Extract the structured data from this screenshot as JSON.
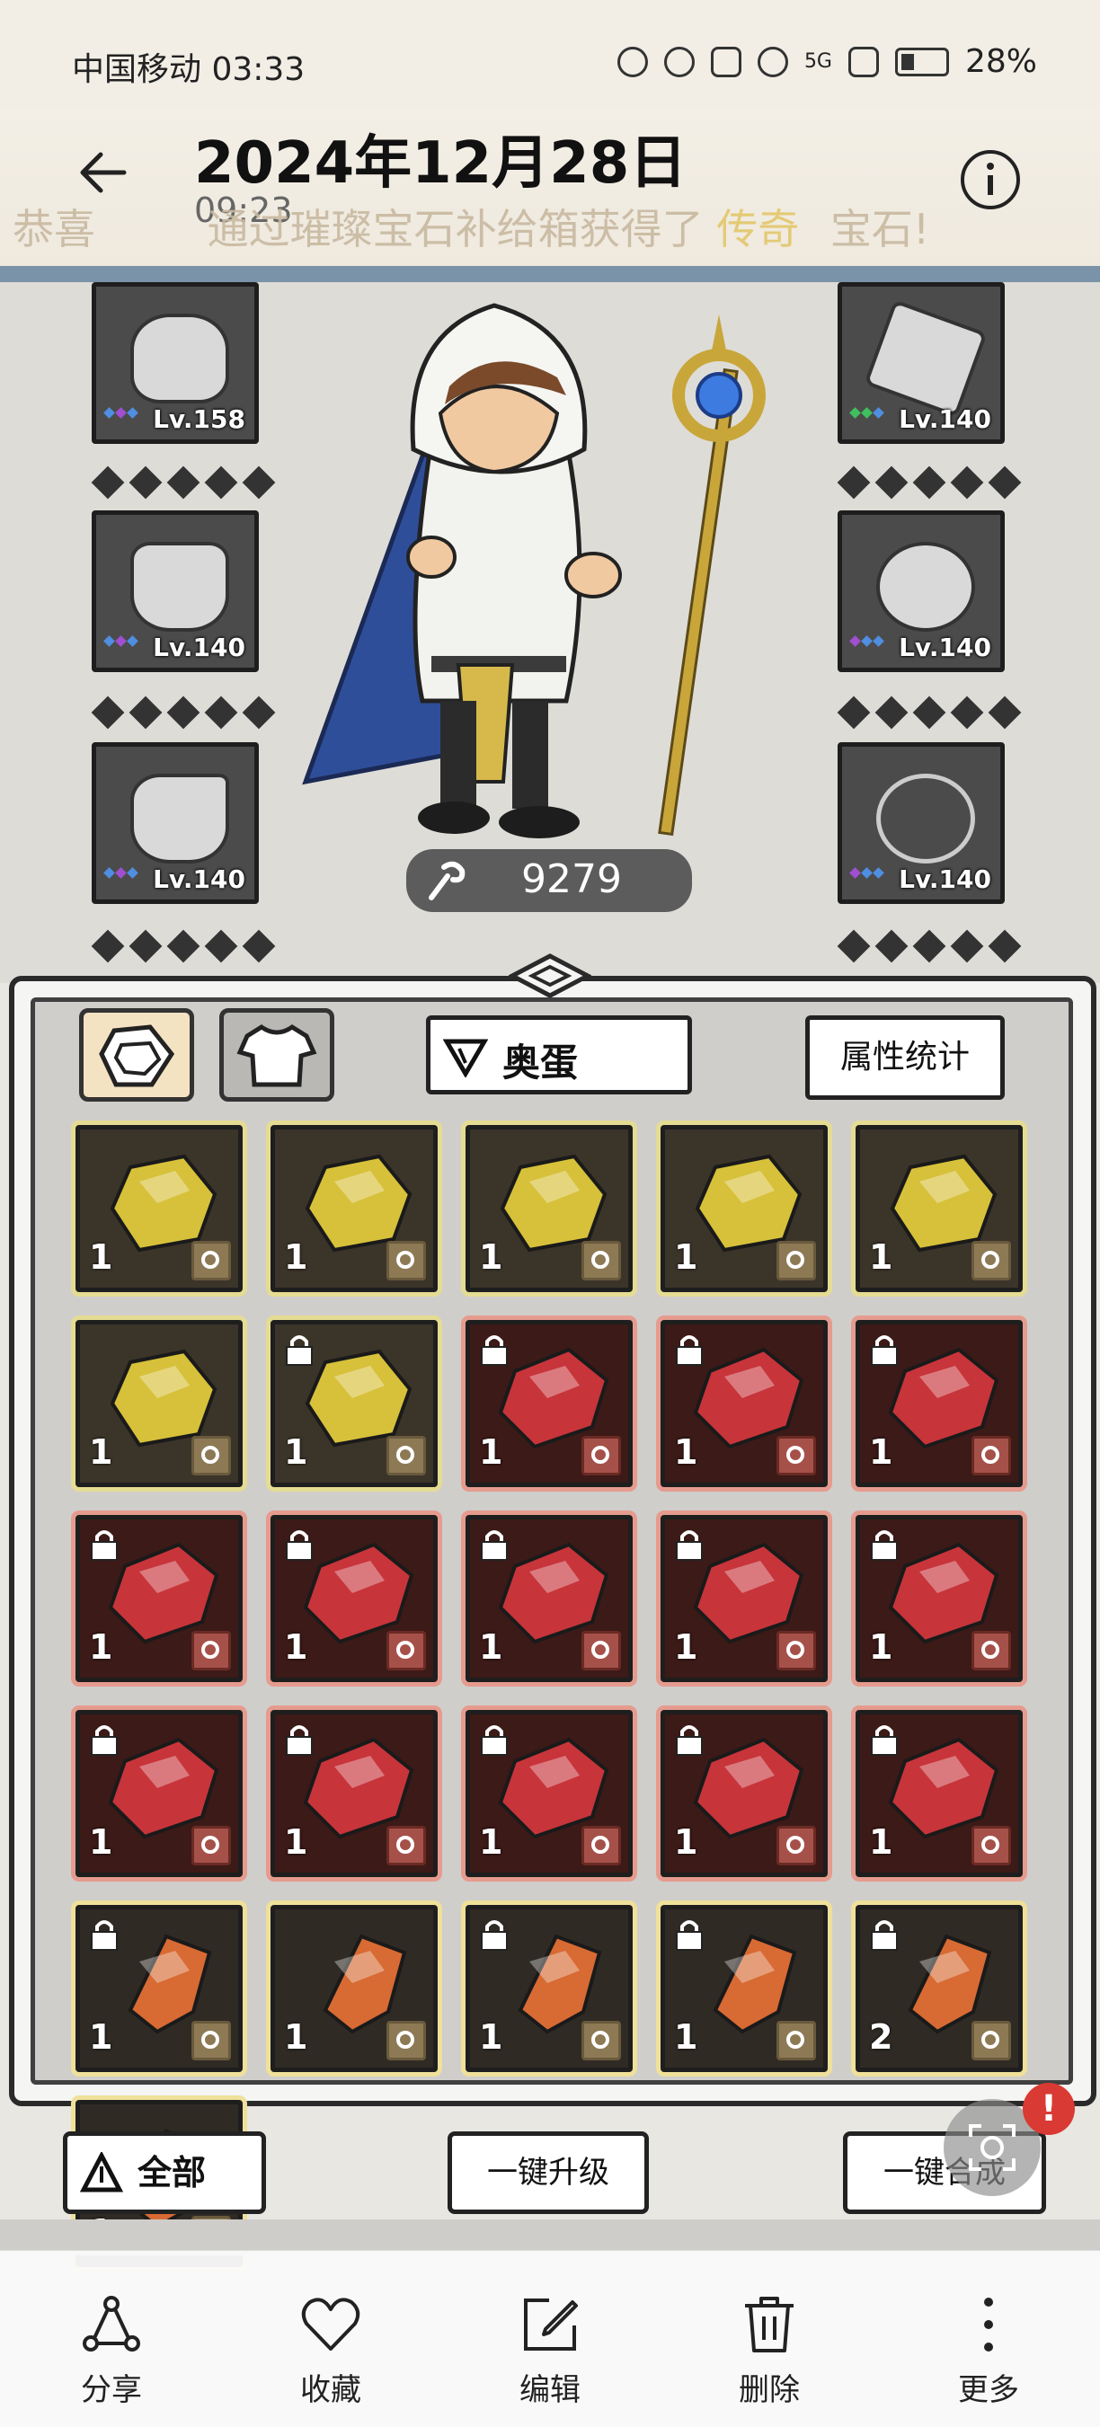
{
  "status_bar": {
    "carrier_time": "中国移动 03:33",
    "network": "5G",
    "battery": "28%"
  },
  "header": {
    "title": "2024年12月28日",
    "subtitle": "09:23",
    "banner_prefix": "恭喜",
    "banner_middle": "通过璀璨宝石补给箱获得了",
    "banner_highlight": "传奇",
    "banner_suffix": "宝石!"
  },
  "equipment": {
    "left": [
      {
        "name": "hood",
        "level": "Lv.158"
      },
      {
        "name": "cape",
        "level": "Lv.140"
      },
      {
        "name": "boots",
        "level": "Lv.140"
      }
    ],
    "right": [
      {
        "name": "weapon",
        "level": "Lv.140"
      },
      {
        "name": "ring",
        "level": "Lv.140"
      },
      {
        "name": "necklace",
        "level": "Lv.140"
      }
    ],
    "power": "9279"
  },
  "inventory": {
    "filter_label": "奥蛋",
    "stats_button": "属性统计",
    "items": [
      {
        "type": "gold",
        "count": "1",
        "locked": false
      },
      {
        "type": "gold",
        "count": "1",
        "locked": false
      },
      {
        "type": "gold",
        "count": "1",
        "locked": false
      },
      {
        "type": "gold",
        "count": "1",
        "locked": false
      },
      {
        "type": "gold",
        "count": "1",
        "locked": false
      },
      {
        "type": "gold",
        "count": "1",
        "locked": false
      },
      {
        "type": "gold",
        "count": "1",
        "locked": true
      },
      {
        "type": "red",
        "count": "1",
        "locked": true
      },
      {
        "type": "red",
        "count": "1",
        "locked": true
      },
      {
        "type": "red",
        "count": "1",
        "locked": true
      },
      {
        "type": "red",
        "count": "1",
        "locked": true
      },
      {
        "type": "red",
        "count": "1",
        "locked": true
      },
      {
        "type": "red",
        "count": "1",
        "locked": true
      },
      {
        "type": "red",
        "count": "1",
        "locked": true
      },
      {
        "type": "red",
        "count": "1",
        "locked": true
      },
      {
        "type": "red",
        "count": "1",
        "locked": true
      },
      {
        "type": "red",
        "count": "1",
        "locked": true
      },
      {
        "type": "red",
        "count": "1",
        "locked": true
      },
      {
        "type": "red",
        "count": "1",
        "locked": true
      },
      {
        "type": "red",
        "count": "1",
        "locked": true
      },
      {
        "type": "orange",
        "count": "1",
        "locked": true
      },
      {
        "type": "orange",
        "count": "1",
        "locked": false
      },
      {
        "type": "orange",
        "count": "1",
        "locked": true
      },
      {
        "type": "orange",
        "count": "1",
        "locked": true
      },
      {
        "type": "orange",
        "count": "2",
        "locked": true
      },
      {
        "type": "orange",
        "count": "1",
        "locked": false
      }
    ]
  },
  "game_buttons": {
    "all": "全部",
    "upgrade": "一键升级",
    "merge": "一键合成",
    "badge": "!"
  },
  "actions": [
    {
      "label": "分享",
      "icon": "share-icon"
    },
    {
      "label": "收藏",
      "icon": "heart-icon"
    },
    {
      "label": "编辑",
      "icon": "edit-icon"
    },
    {
      "label": "删除",
      "icon": "trash-icon"
    },
    {
      "label": "更多",
      "icon": "more-icon"
    }
  ],
  "colors": {
    "gold_gem": "#d7c13a",
    "red_gem": "#c7343a",
    "orange_gem": "#d86a33",
    "accent_bar": "#7a93a8"
  }
}
